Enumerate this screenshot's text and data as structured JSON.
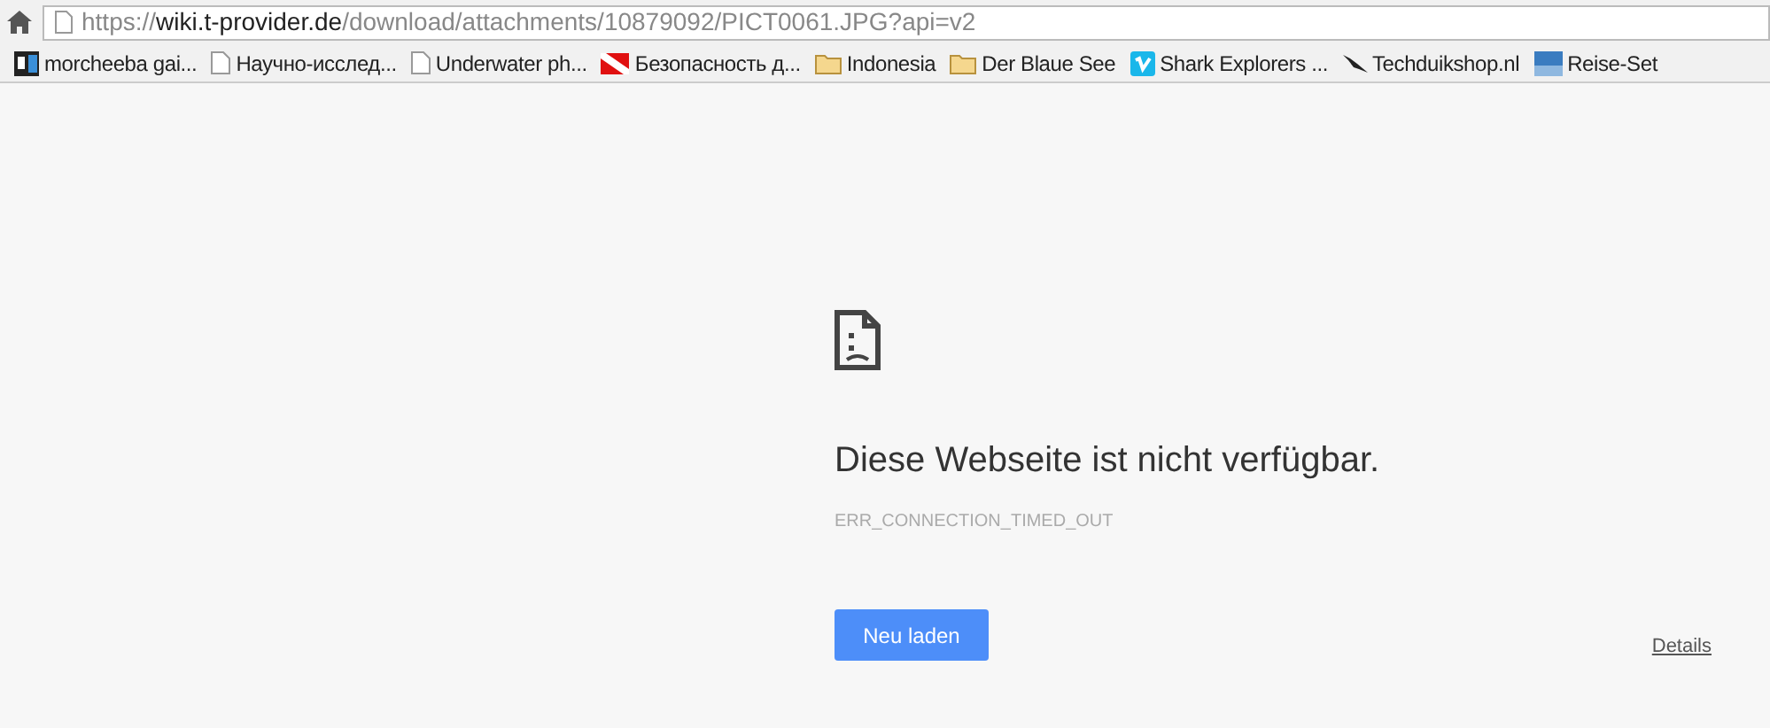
{
  "address_bar": {
    "url_parts": [
      {
        "text": "https://",
        "kind": "scheme"
      },
      {
        "text": "wiki.t-provider.de",
        "kind": "host"
      },
      {
        "text": "/download/attachments/10879092/PICT0061.JPG?api=v2",
        "kind": "path"
      }
    ]
  },
  "bookmarks": [
    {
      "label": "morcheeba gai...",
      "kind": "logo"
    },
    {
      "label": "Научно-исслед...",
      "kind": "page"
    },
    {
      "label": "Underwater ph...",
      "kind": "page"
    },
    {
      "label": "Безопасность д...",
      "kind": "flag"
    },
    {
      "label": "Indonesia",
      "kind": "folder"
    },
    {
      "label": "Der Blaue See",
      "kind": "folder"
    },
    {
      "label": "Shark Explorers ...",
      "kind": "vimeo"
    },
    {
      "label": "Techduikshop.nl",
      "kind": "shark"
    },
    {
      "label": "Reise-Set",
      "kind": "shop"
    }
  ],
  "error": {
    "heading": "Diese Webseite ist nicht verfügbar.",
    "code": "ERR_CONNECTION_TIMED_OUT",
    "reload_button": "Neu laden",
    "details_link": "Details"
  }
}
